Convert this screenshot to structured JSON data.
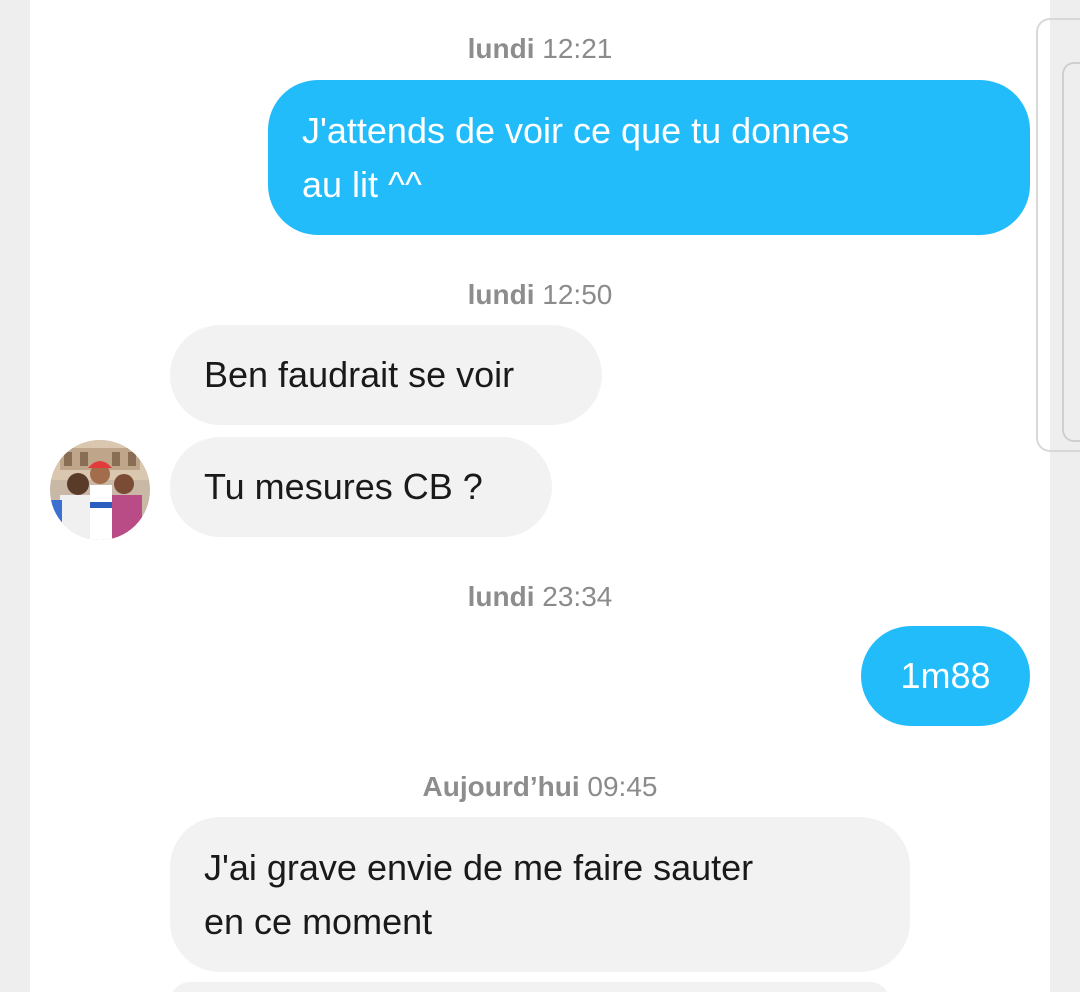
{
  "conversation": {
    "messages": [
      {
        "kind": "timestamp",
        "day": "lundi",
        "time": "12:21"
      },
      {
        "kind": "sent",
        "lines": [
          "J'attends de voir ce que tu donnes",
          "au lit ^^"
        ]
      },
      {
        "kind": "timestamp",
        "day": "lundi",
        "time": "12:50"
      },
      {
        "kind": "received",
        "lines": [
          "Ben faudrait se voir"
        ]
      },
      {
        "kind": "received",
        "lines": [
          "Tu mesures CB ?"
        ]
      },
      {
        "kind": "timestamp",
        "day": "lundi",
        "time": "23:34"
      },
      {
        "kind": "sent",
        "lines": [
          "1m88"
        ]
      },
      {
        "kind": "timestamp",
        "day": "Aujourd’hui",
        "time": "09:45"
      },
      {
        "kind": "received",
        "lines": [
          "J'ai grave envie de me faire sauter",
          "en ce moment"
        ]
      }
    ]
  },
  "colors": {
    "sent_bubble": "#22bcfb",
    "received_bubble": "#f2f2f2",
    "timestamp_text": "#8b8b8b"
  },
  "icons": {
    "contact_avatar": "contact-avatar-photo"
  }
}
